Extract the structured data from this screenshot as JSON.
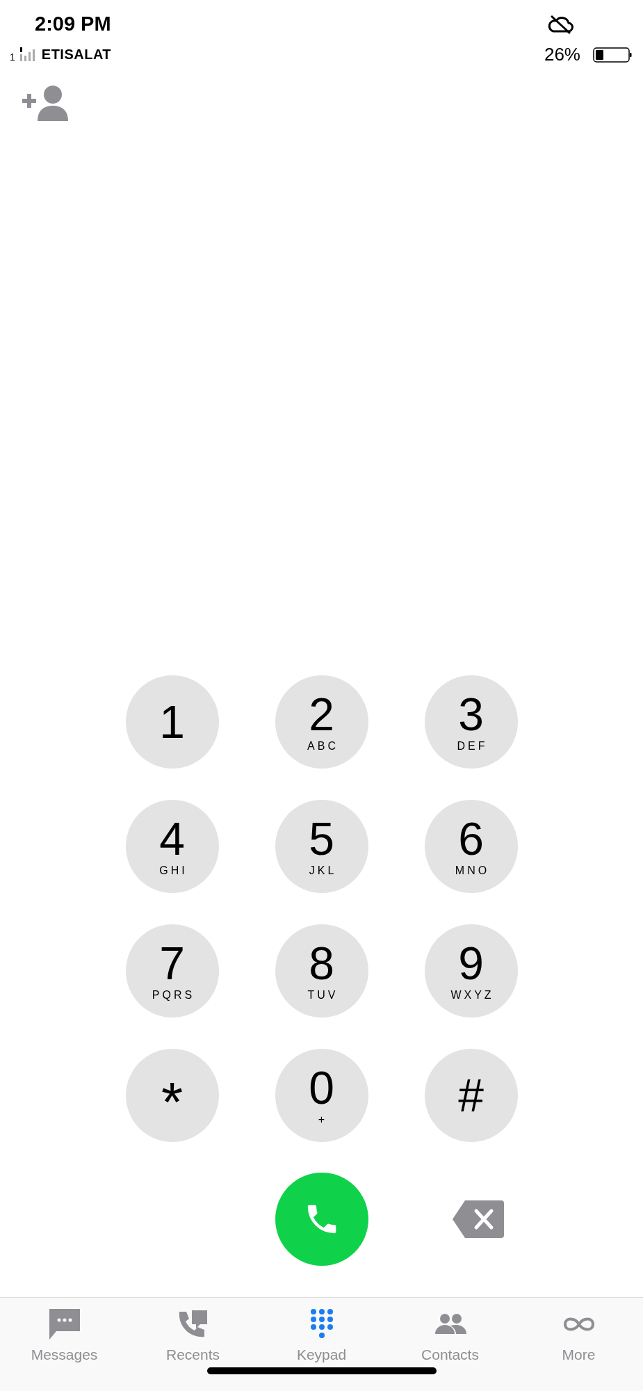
{
  "status_bar": {
    "time": "2:09 PM",
    "sim_slot": "1",
    "carrier": "ETISALAT",
    "battery_percent": "26%"
  },
  "keys": [
    {
      "digit": "1"
    },
    {
      "digit": "2",
      "letters": "ABC"
    },
    {
      "digit": "3",
      "letters": "DEF"
    },
    {
      "digit": "4",
      "letters": "GHI"
    },
    {
      "digit": "5",
      "letters": "JKL"
    },
    {
      "digit": "6",
      "letters": "MNO"
    },
    {
      "digit": "7",
      "letters": "PQRS"
    },
    {
      "digit": "8",
      "letters": "TUV"
    },
    {
      "digit": "9",
      "letters": "WXYZ"
    },
    {
      "digit": "*"
    },
    {
      "digit": "0",
      "letters": "+"
    },
    {
      "digit": "#"
    }
  ],
  "tabs": [
    {
      "label": "Messages",
      "selected": false
    },
    {
      "label": "Recents",
      "selected": false
    },
    {
      "label": "Keypad",
      "selected": true
    },
    {
      "label": "Contacts",
      "selected": false
    },
    {
      "label": "More",
      "selected": false
    }
  ]
}
